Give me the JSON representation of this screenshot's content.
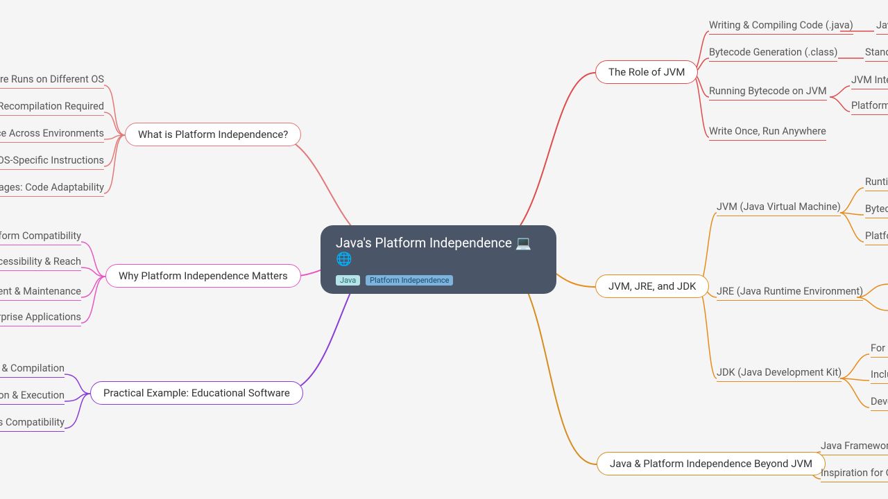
{
  "root": {
    "title": "Java's Platform Independence 💻🌐",
    "tags": [
      "Java",
      "Platform Independence"
    ]
  },
  "left": {
    "b1": {
      "label": "What is Platform Independence?",
      "children": [
        "Software Runs on Different OS",
        "No Recompilation Required",
        "Consistent Experience Across Environments",
        "Traditional Languages: OS-Specific Instructions",
        "High-Level Languages: Code Adaptability"
      ]
    },
    "b2": {
      "label": "Why Platform Independence Matters",
      "children": [
        "Cross-Platform Compatibility",
        "User Accessibility & Reach",
        "Streamlined Development & Maintenance",
        "Essential for Enterprise Applications"
      ]
    },
    "b3": {
      "label": "Practical Example: Educational Software",
      "children": [
        "Development & Compilation",
        "Distribution & Execution",
        "Seamless Compatibility"
      ]
    }
  },
  "right": {
    "b1": {
      "label": "The Role of JVM",
      "children": {
        "c1": "Writing & Compiling Code (.java)",
        "c1r": "Java",
        "c2": "Bytecode Generation (.class)",
        "c2r": "Standard",
        "c3": "Running Bytecode on JVM",
        "c3a": "JVM Interprets",
        "c3b": "Platform-Specific",
        "c4": "Write Once, Run Anywhere"
      }
    },
    "b2": {
      "label": "JVM, JRE, and JDK",
      "children": {
        "c1": "JVM (Java Virtual Machine)",
        "c1a": "Runtime",
        "c1b": "Bytecode",
        "c1c": "Platform",
        "c2": "JRE (Java Runtime Environment)",
        "c3": "JDK (Java Development Kit)",
        "c3a": "For Developers",
        "c3b": "Includes",
        "c3c": "Development"
      }
    },
    "b3": {
      "label": "Java & Platform Independence Beyond JVM",
      "children": {
        "c1": "Java Frameworks",
        "c2": "Inspiration for Other"
      }
    }
  },
  "colors": {
    "red": "#e04a4a",
    "pink": "#e855c3",
    "purple": "#8a3bd8",
    "orange": "#e88b1a",
    "darkorange": "#d58d1d",
    "lightred": "#e27878"
  }
}
